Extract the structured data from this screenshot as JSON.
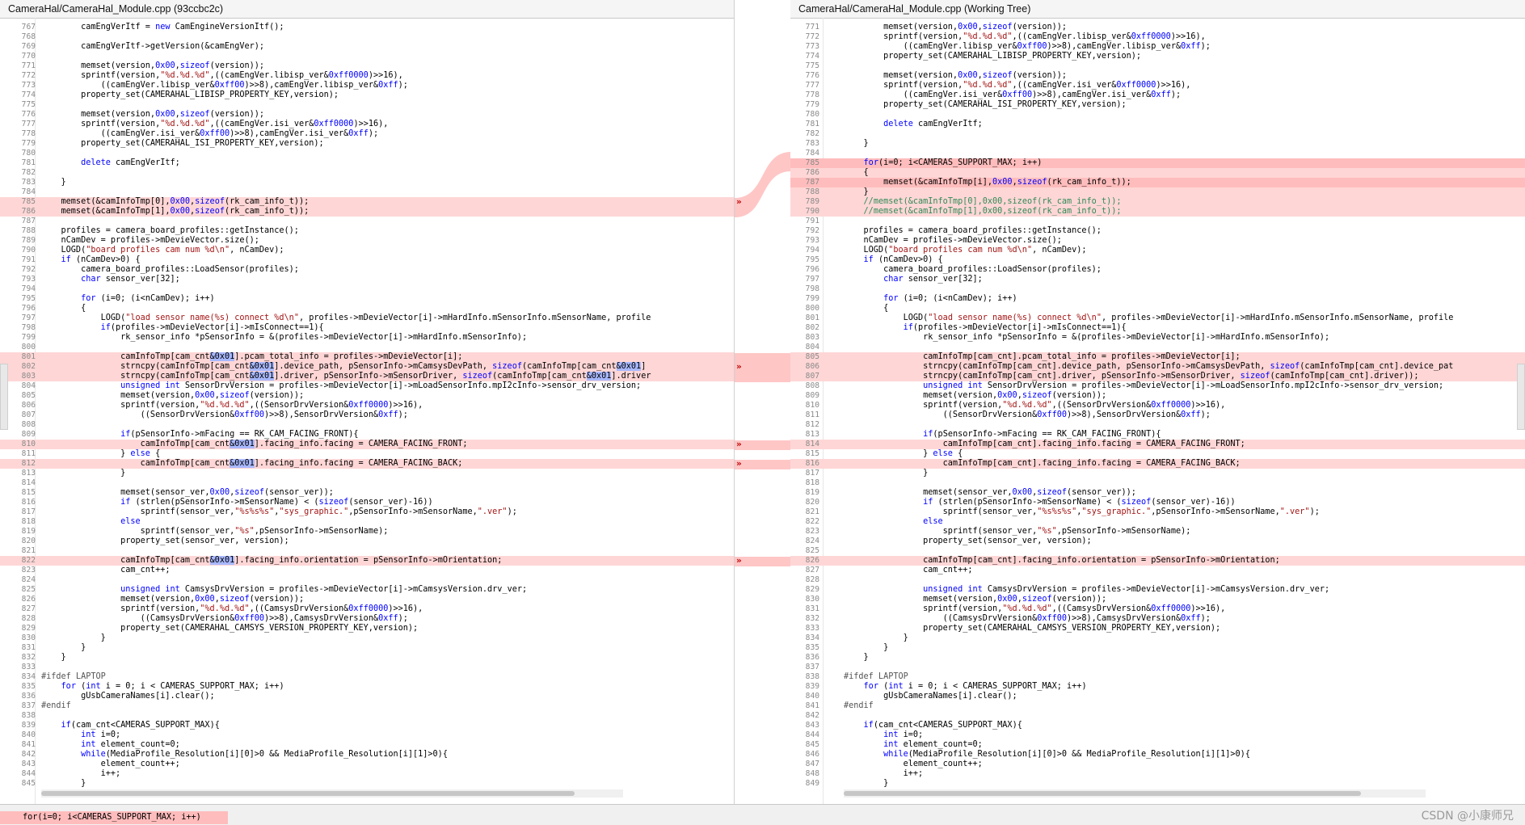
{
  "left": {
    "title": "CameraHal/CameraHal_Module.cpp (93ccbc2c)",
    "lines": [
      {
        "n": "767",
        "t": "        camEngVerItf = new CamEngineVersionItf();"
      },
      {
        "n": "768",
        "t": ""
      },
      {
        "n": "769",
        "t": "        camEngVerItf->getVersion(&camEngVer);"
      },
      {
        "n": "770",
        "t": ""
      },
      {
        "n": "771",
        "t": "        memset(version,0x00,sizeof(version));"
      },
      {
        "n": "772",
        "t": "        sprintf(version,\"%d.%d.%d\",((camEngVer.libisp_ver&0xff0000)>>16),"
      },
      {
        "n": "773",
        "t": "            ((camEngVer.libisp_ver&0xff00)>>8),camEngVer.libisp_ver&0xff);"
      },
      {
        "n": "774",
        "t": "        property_set(CAMERAHAL_LIBISP_PROPERTY_KEY,version);"
      },
      {
        "n": "775",
        "t": ""
      },
      {
        "n": "776",
        "t": "        memset(version,0x00,sizeof(version));"
      },
      {
        "n": "777",
        "t": "        sprintf(version,\"%d.%d.%d\",((camEngVer.isi_ver&0xff0000)>>16),"
      },
      {
        "n": "778",
        "t": "            ((camEngVer.isi_ver&0xff00)>>8),camEngVer.isi_ver&0xff);"
      },
      {
        "n": "779",
        "t": "        property_set(CAMERAHAL_ISI_PROPERTY_KEY,version);"
      },
      {
        "n": "780",
        "t": ""
      },
      {
        "n": "781",
        "t": "        delete camEngVerItf;"
      },
      {
        "n": "782",
        "t": ""
      },
      {
        "n": "783",
        "t": "    }"
      },
      {
        "n": "784",
        "t": ""
      },
      {
        "n": "785",
        "t": "    memset(&camInfoTmp[0],0x00,sizeof(rk_cam_info_t));",
        "c": "changed"
      },
      {
        "n": "786",
        "t": "    memset(&camInfoTmp[1],0x00,sizeof(rk_cam_info_t));",
        "c": "changed"
      },
      {
        "n": "787",
        "t": ""
      },
      {
        "n": "788",
        "t": "    profiles = camera_board_profiles::getInstance();"
      },
      {
        "n": "789",
        "t": "    nCamDev = profiles->mDevieVector.size();"
      },
      {
        "n": "790",
        "t": "    LOGD(\"board profiles cam num %d\\n\", nCamDev);"
      },
      {
        "n": "791",
        "t": "    if (nCamDev>0) {"
      },
      {
        "n": "792",
        "t": "        camera_board_profiles::LoadSensor(profiles);"
      },
      {
        "n": "793",
        "t": "        char sensor_ver[32];"
      },
      {
        "n": "794",
        "t": ""
      },
      {
        "n": "795",
        "t": "        for (i=0; (i<nCamDev); i++)"
      },
      {
        "n": "796",
        "t": "        {"
      },
      {
        "n": "797",
        "t": "            LOGD(\"load sensor name(%s) connect %d\\n\", profiles->mDevieVector[i]->mHardInfo.mSensorInfo.mSensorName, profile"
      },
      {
        "n": "798",
        "t": "            if(profiles->mDevieVector[i]->mIsConnect==1){"
      },
      {
        "n": "799",
        "t": "                rk_sensor_info *pSensorInfo = &(profiles->mDevieVector[i]->mHardInfo.mSensorInfo);"
      },
      {
        "n": "800",
        "t": ""
      },
      {
        "n": "801",
        "t": "                camInfoTmp[cam_cnt&0x01].pcam_total_info = profiles->mDevieVector[i];",
        "c": "changed"
      },
      {
        "n": "802",
        "t": "                strncpy(camInfoTmp[cam_cnt&0x01].device_path, pSensorInfo->mCamsysDevPath, sizeof(camInfoTmp[cam_cnt&0x01]",
        "c": "changed"
      },
      {
        "n": "803",
        "t": "                strncpy(camInfoTmp[cam_cnt&0x01].driver, pSensorInfo->mSensorDriver, sizeof(camInfoTmp[cam_cnt&0x01].driver",
        "c": "changed"
      },
      {
        "n": "804",
        "t": "                unsigned int SensorDrvVersion = profiles->mDevieVector[i]->mLoadSensorInfo.mpI2cInfo->sensor_drv_version;"
      },
      {
        "n": "805",
        "t": "                memset(version,0x00,sizeof(version));"
      },
      {
        "n": "806",
        "t": "                sprintf(version,\"%d.%d.%d\",((SensorDrvVersion&0xff0000)>>16),"
      },
      {
        "n": "807",
        "t": "                    ((SensorDrvVersion&0xff00)>>8),SensorDrvVersion&0xff);"
      },
      {
        "n": "808",
        "t": ""
      },
      {
        "n": "809",
        "t": "                if(pSensorInfo->mFacing == RK_CAM_FACING_FRONT){"
      },
      {
        "n": "810",
        "t": "                    camInfoTmp[cam_cnt&0x01].facing_info.facing = CAMERA_FACING_FRONT;",
        "c": "changed"
      },
      {
        "n": "811",
        "t": "                } else {"
      },
      {
        "n": "812",
        "t": "                    camInfoTmp[cam_cnt&0x01].facing_info.facing = CAMERA_FACING_BACK;",
        "c": "changed"
      },
      {
        "n": "813",
        "t": "                }"
      },
      {
        "n": "814",
        "t": ""
      },
      {
        "n": "815",
        "t": "                memset(sensor_ver,0x00,sizeof(sensor_ver));"
      },
      {
        "n": "816",
        "t": "                if (strlen(pSensorInfo->mSensorName) < (sizeof(sensor_ver)-16))"
      },
      {
        "n": "817",
        "t": "                    sprintf(sensor_ver,\"%s%s%s\",\"sys_graphic.\",pSensorInfo->mSensorName,\".ver\");"
      },
      {
        "n": "818",
        "t": "                else"
      },
      {
        "n": "819",
        "t": "                    sprintf(sensor_ver,\"%s\",pSensorInfo->mSensorName);"
      },
      {
        "n": "820",
        "t": "                property_set(sensor_ver, version);"
      },
      {
        "n": "821",
        "t": ""
      },
      {
        "n": "822",
        "t": "                camInfoTmp[cam_cnt&0x01].facing_info.orientation = pSensorInfo->mOrientation;",
        "c": "changed"
      },
      {
        "n": "823",
        "t": "                cam_cnt++;"
      },
      {
        "n": "824",
        "t": ""
      },
      {
        "n": "825",
        "t": "                unsigned int CamsysDrvVersion = profiles->mDevieVector[i]->mCamsysVersion.drv_ver;"
      },
      {
        "n": "826",
        "t": "                memset(version,0x00,sizeof(version));"
      },
      {
        "n": "827",
        "t": "                sprintf(version,\"%d.%d.%d\",((CamsysDrvVersion&0xff0000)>>16),"
      },
      {
        "n": "828",
        "t": "                    ((CamsysDrvVersion&0xff00)>>8),CamsysDrvVersion&0xff);"
      },
      {
        "n": "829",
        "t": "                property_set(CAMERAHAL_CAMSYS_VERSION_PROPERTY_KEY,version);"
      },
      {
        "n": "830",
        "t": "            }"
      },
      {
        "n": "831",
        "t": "        }"
      },
      {
        "n": "832",
        "t": "    }"
      },
      {
        "n": "833",
        "t": ""
      },
      {
        "n": "834",
        "t": "#ifdef LAPTOP"
      },
      {
        "n": "835",
        "t": "    for (int i = 0; i < CAMERAS_SUPPORT_MAX; i++)"
      },
      {
        "n": "836",
        "t": "        gUsbCameraNames[i].clear();"
      },
      {
        "n": "837",
        "t": "#endif"
      },
      {
        "n": "838",
        "t": ""
      },
      {
        "n": "839",
        "t": "    if(cam_cnt<CAMERAS_SUPPORT_MAX){"
      },
      {
        "n": "840",
        "t": "        int i=0;"
      },
      {
        "n": "841",
        "t": "        int element_count=0;"
      },
      {
        "n": "842",
        "t": "        while(MediaProfile_Resolution[i][0]>0 && MediaProfile_Resolution[i][1]>0){"
      },
      {
        "n": "843",
        "t": "            element_count++;"
      },
      {
        "n": "844",
        "t": "            i++;"
      },
      {
        "n": "845",
        "t": "        }"
      }
    ]
  },
  "right": {
    "title": "CameraHal/CameraHal_Module.cpp (Working Tree)",
    "lines": [
      {
        "n": "771",
        "t": "        memset(version,0x00,sizeof(version));"
      },
      {
        "n": "772",
        "t": "        sprintf(version,\"%d.%d.%d\",((camEngVer.libisp_ver&0xff0000)>>16),"
      },
      {
        "n": "773",
        "t": "            ((camEngVer.libisp_ver&0xff00)>>8),camEngVer.libisp_ver&0xff);"
      },
      {
        "n": "774",
        "t": "        property_set(CAMERAHAL_LIBISP_PROPERTY_KEY,version);"
      },
      {
        "n": "775",
        "t": ""
      },
      {
        "n": "776",
        "t": "        memset(version,0x00,sizeof(version));"
      },
      {
        "n": "777",
        "t": "        sprintf(version,\"%d.%d.%d\",((camEngVer.isi_ver&0xff0000)>>16),"
      },
      {
        "n": "778",
        "t": "            ((camEngVer.isi_ver&0xff00)>>8),camEngVer.isi_ver&0xff);"
      },
      {
        "n": "779",
        "t": "        property_set(CAMERAHAL_ISI_PROPERTY_KEY,version);"
      },
      {
        "n": "780",
        "t": ""
      },
      {
        "n": "781",
        "t": "        delete camEngVerItf;"
      },
      {
        "n": "782",
        "t": ""
      },
      {
        "n": "783",
        "t": "    }"
      },
      {
        "n": "784",
        "t": ""
      },
      {
        "n": "785",
        "t": "    for(i=0; i<CAMERAS_SUPPORT_MAX; i++)",
        "c": "changed-strong"
      },
      {
        "n": "786",
        "t": "    {",
        "c": "changed"
      },
      {
        "n": "787",
        "t": "        memset(&camInfoTmp[i],0x00,sizeof(rk_cam_info_t));",
        "c": "changed-strong"
      },
      {
        "n": "788",
        "t": "    }",
        "c": "changed"
      },
      {
        "n": "789",
        "t": "    //memset(&camInfoTmp[0],0x00,sizeof(rk_cam_info_t));",
        "c": "changed"
      },
      {
        "n": "790",
        "t": "    //memset(&camInfoTmp[1],0x00,sizeof(rk_cam_info_t));",
        "c": "changed"
      },
      {
        "n": "791",
        "t": ""
      },
      {
        "n": "792",
        "t": "    profiles = camera_board_profiles::getInstance();"
      },
      {
        "n": "793",
        "t": "    nCamDev = profiles->mDevieVector.size();"
      },
      {
        "n": "794",
        "t": "    LOGD(\"board profiles cam num %d\\n\", nCamDev);"
      },
      {
        "n": "795",
        "t": "    if (nCamDev>0) {"
      },
      {
        "n": "796",
        "t": "        camera_board_profiles::LoadSensor(profiles);"
      },
      {
        "n": "797",
        "t": "        char sensor_ver[32];"
      },
      {
        "n": "798",
        "t": ""
      },
      {
        "n": "799",
        "t": "        for (i=0; (i<nCamDev); i++)"
      },
      {
        "n": "800",
        "t": "        {"
      },
      {
        "n": "801",
        "t": "            LOGD(\"load sensor name(%s) connect %d\\n\", profiles->mDevieVector[i]->mHardInfo.mSensorInfo.mSensorName, profile"
      },
      {
        "n": "802",
        "t": "            if(profiles->mDevieVector[i]->mIsConnect==1){"
      },
      {
        "n": "803",
        "t": "                rk_sensor_info *pSensorInfo = &(profiles->mDevieVector[i]->mHardInfo.mSensorInfo);"
      },
      {
        "n": "804",
        "t": ""
      },
      {
        "n": "805",
        "t": "                camInfoTmp[cam_cnt].pcam_total_info = profiles->mDevieVector[i];",
        "c": "changed"
      },
      {
        "n": "806",
        "t": "                strncpy(camInfoTmp[cam_cnt].device_path, pSensorInfo->mCamsysDevPath, sizeof(camInfoTmp[cam_cnt].device_pat",
        "c": "changed"
      },
      {
        "n": "807",
        "t": "                strncpy(camInfoTmp[cam_cnt].driver, pSensorInfo->mSensorDriver, sizeof(camInfoTmp[cam_cnt].driver));",
        "c": "changed"
      },
      {
        "n": "808",
        "t": "                unsigned int SensorDrvVersion = profiles->mDevieVector[i]->mLoadSensorInfo.mpI2cInfo->sensor_drv_version;"
      },
      {
        "n": "809",
        "t": "                memset(version,0x00,sizeof(version));"
      },
      {
        "n": "810",
        "t": "                sprintf(version,\"%d.%d.%d\",((SensorDrvVersion&0xff0000)>>16),"
      },
      {
        "n": "811",
        "t": "                    ((SensorDrvVersion&0xff00)>>8),SensorDrvVersion&0xff);"
      },
      {
        "n": "812",
        "t": ""
      },
      {
        "n": "813",
        "t": "                if(pSensorInfo->mFacing == RK_CAM_FACING_FRONT){"
      },
      {
        "n": "814",
        "t": "                    camInfoTmp[cam_cnt].facing_info.facing = CAMERA_FACING_FRONT;",
        "c": "changed"
      },
      {
        "n": "815",
        "t": "                } else {"
      },
      {
        "n": "816",
        "t": "                    camInfoTmp[cam_cnt].facing_info.facing = CAMERA_FACING_BACK;",
        "c": "changed"
      },
      {
        "n": "817",
        "t": "                }"
      },
      {
        "n": "818",
        "t": ""
      },
      {
        "n": "819",
        "t": "                memset(sensor_ver,0x00,sizeof(sensor_ver));"
      },
      {
        "n": "820",
        "t": "                if (strlen(pSensorInfo->mSensorName) < (sizeof(sensor_ver)-16))"
      },
      {
        "n": "821",
        "t": "                    sprintf(sensor_ver,\"%s%s%s\",\"sys_graphic.\",pSensorInfo->mSensorName,\".ver\");"
      },
      {
        "n": "822",
        "t": "                else"
      },
      {
        "n": "823",
        "t": "                    sprintf(sensor_ver,\"%s\",pSensorInfo->mSensorName);"
      },
      {
        "n": "824",
        "t": "                property_set(sensor_ver, version);"
      },
      {
        "n": "825",
        "t": ""
      },
      {
        "n": "826",
        "t": "                camInfoTmp[cam_cnt].facing_info.orientation = pSensorInfo->mOrientation;",
        "c": "changed"
      },
      {
        "n": "827",
        "t": "                cam_cnt++;"
      },
      {
        "n": "828",
        "t": ""
      },
      {
        "n": "829",
        "t": "                unsigned int CamsysDrvVersion = profiles->mDevieVector[i]->mCamsysVersion.drv_ver;"
      },
      {
        "n": "830",
        "t": "                memset(version,0x00,sizeof(version));"
      },
      {
        "n": "831",
        "t": "                sprintf(version,\"%d.%d.%d\",((CamsysDrvVersion&0xff0000)>>16),"
      },
      {
        "n": "832",
        "t": "                    ((CamsysDrvVersion&0xff00)>>8),CamsysDrvVersion&0xff);"
      },
      {
        "n": "833",
        "t": "                property_set(CAMERAHAL_CAMSYS_VERSION_PROPERTY_KEY,version);"
      },
      {
        "n": "834",
        "t": "            }"
      },
      {
        "n": "835",
        "t": "        }"
      },
      {
        "n": "836",
        "t": "    }"
      },
      {
        "n": "837",
        "t": ""
      },
      {
        "n": "838",
        "t": "#ifdef LAPTOP"
      },
      {
        "n": "839",
        "t": "    for (int i = 0; i < CAMERAS_SUPPORT_MAX; i++)"
      },
      {
        "n": "840",
        "t": "        gUsbCameraNames[i].clear();"
      },
      {
        "n": "841",
        "t": "#endif"
      },
      {
        "n": "842",
        "t": ""
      },
      {
        "n": "843",
        "t": "    if(cam_cnt<CAMERAS_SUPPORT_MAX){"
      },
      {
        "n": "844",
        "t": "        int i=0;"
      },
      {
        "n": "845",
        "t": "        int element_count=0;"
      },
      {
        "n": "846",
        "t": "        while(MediaProfile_Resolution[i][0]>0 && MediaProfile_Resolution[i][1]>0){"
      },
      {
        "n": "847",
        "t": "            element_count++;"
      },
      {
        "n": "848",
        "t": "            i++;"
      },
      {
        "n": "849",
        "t": "        }"
      }
    ]
  },
  "diff_arrows": [
    {
      "line": "785"
    },
    {
      "line": "802"
    },
    {
      "line": "810"
    },
    {
      "line": "812"
    },
    {
      "line": "822"
    }
  ],
  "arrow_glyph": "»",
  "bottom_preview": "for(i=0; i<CAMERAS_SUPPORT_MAX; i++)",
  "watermark": "CSDN @小康师兄",
  "colors": {
    "changed": "#ffd6d6",
    "changed_strong": "#ffbcbc",
    "token_highlight": "#a8b8ff",
    "keyword": "#0000ff",
    "string": "#a31515",
    "comment": "#2e8b57"
  }
}
